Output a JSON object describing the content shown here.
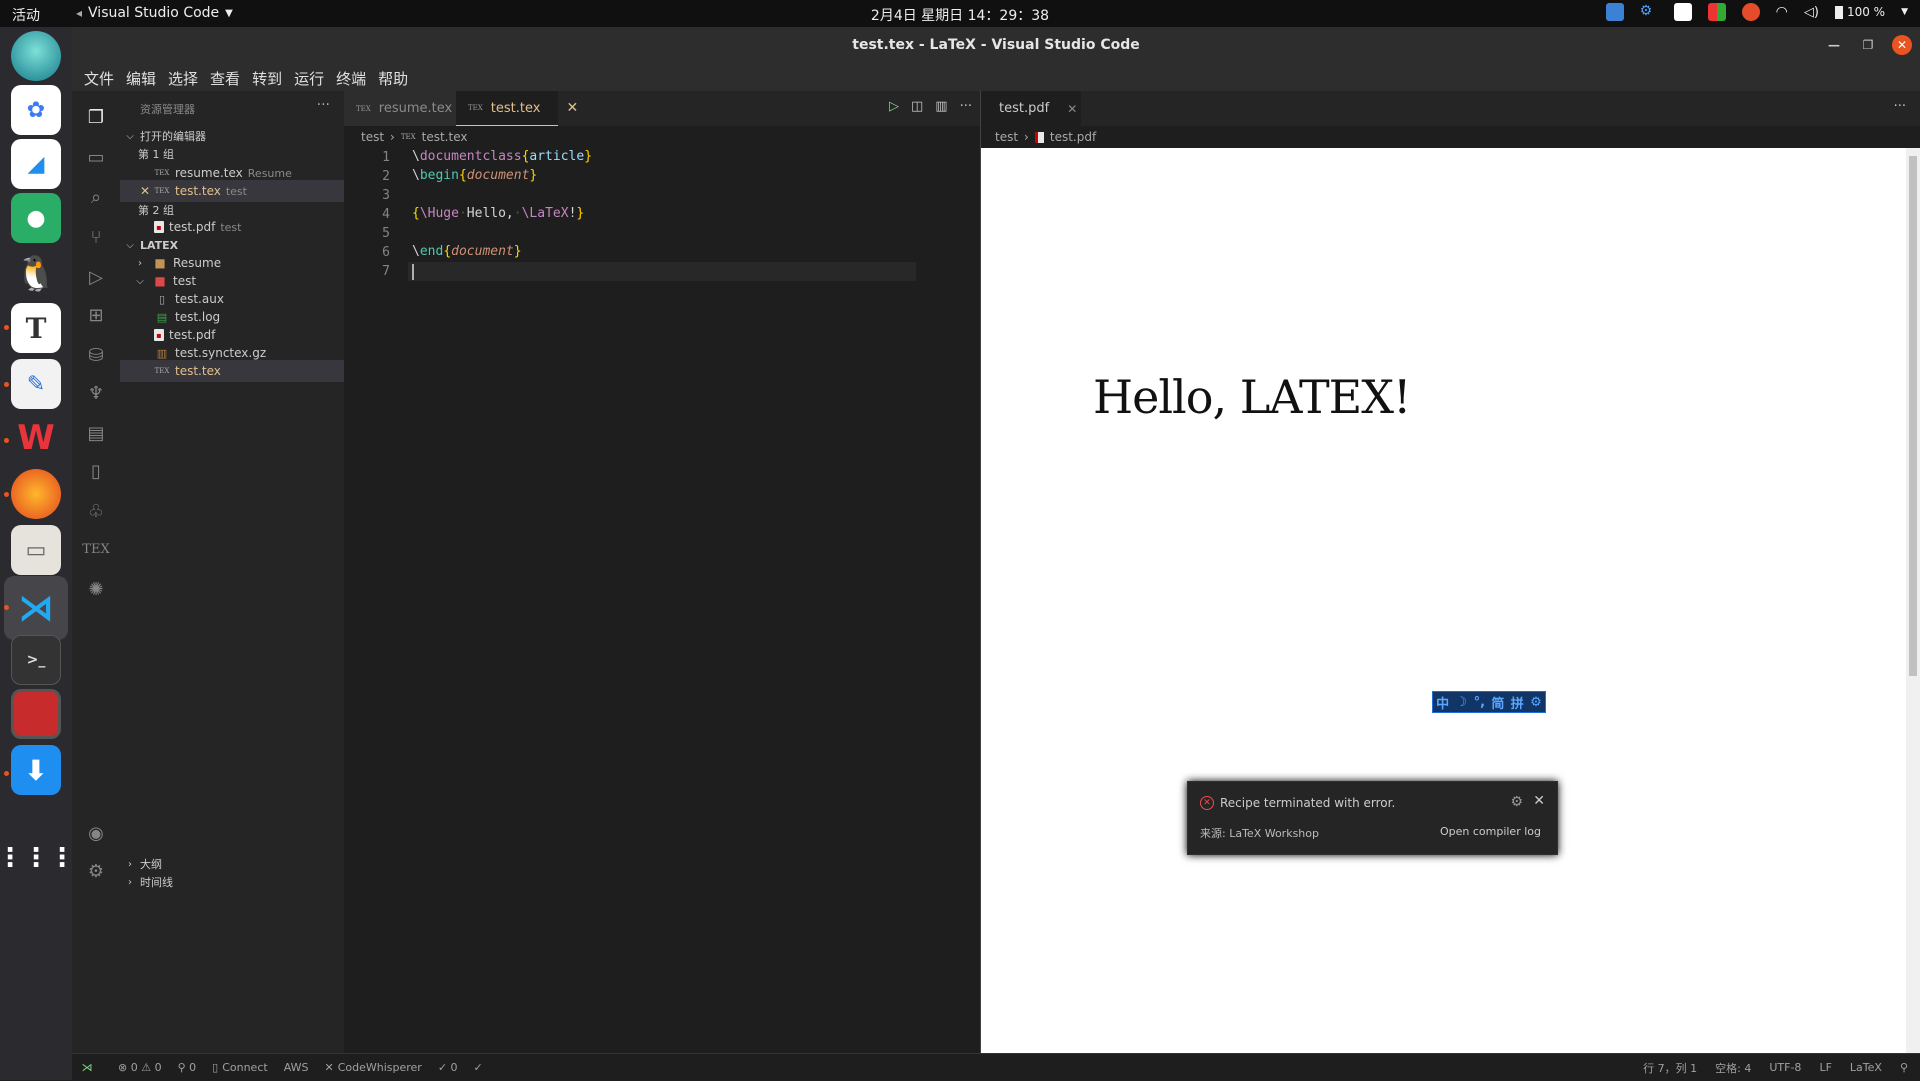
{
  "topbar": {
    "activities": "活动",
    "app_name": "Visual Studio Code",
    "clock": "2月4日 星期日 14：29：38",
    "battery": "100 %"
  },
  "window": {
    "title": "test.tex - LaTeX - Visual Studio Code"
  },
  "menu": [
    "文件",
    "编辑",
    "选择",
    "查看",
    "转到",
    "运行",
    "终端",
    "帮助"
  ],
  "sidebar": {
    "header": "资源管理器",
    "more": "···",
    "open_editors": "打开的编辑器",
    "group1": "第 1 组",
    "group1_items": [
      {
        "name": "resume.tex",
        "desc": "Resume"
      },
      {
        "name": "test.tex",
        "desc": "test"
      }
    ],
    "group2": "第 2 组",
    "group2_items": [
      {
        "name": "test.pdf",
        "desc": "test"
      }
    ],
    "folder_root": "LATEX",
    "folders": [
      "Resume",
      "test"
    ],
    "files": [
      "test.aux",
      "test.log",
      "test.pdf",
      "test.synctex.gz",
      "test.tex"
    ],
    "outline": "大纲",
    "timeline": "时间线"
  },
  "editor1": {
    "tabs": [
      "resume.tex",
      "test.tex"
    ],
    "breadcrumb": [
      "test",
      "test.tex"
    ],
    "line_numbers": [
      "1",
      "2",
      "3",
      "4",
      "5",
      "6",
      "7"
    ]
  },
  "editor2": {
    "tab": "test.pdf",
    "breadcrumb": [
      "test",
      "test.pdf"
    ],
    "pdf_text": "Hello, LATEX!"
  },
  "ime": [
    "中",
    "☽",
    "°,",
    "简",
    "拼",
    "⚙"
  ],
  "toast": {
    "message": "Recipe terminated with error.",
    "source": "来源: LaTeX Workshop",
    "action": "Open compiler log"
  },
  "status": {
    "problems": "⊗ 0 ⚠ 0",
    "ports": "⚲ 0",
    "connect": "Connect",
    "aws": "AWS",
    "codewhisperer": "CodeWhisperer",
    "check_count": "✓ 0",
    "position": "行 7，列 1",
    "spaces": "空格: 4",
    "encoding": "UTF-8",
    "eol": "LF",
    "language": "LaTeX"
  },
  "colors": {
    "accent": "#e2c08d",
    "ubuntu_orange": "#e95420",
    "error": "#f14c4c"
  }
}
